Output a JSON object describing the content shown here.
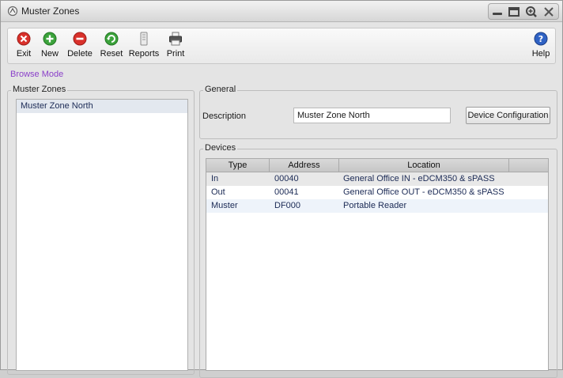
{
  "window": {
    "title": "Muster Zones"
  },
  "toolbar": {
    "exit": "Exit",
    "new": "New",
    "delete": "Delete",
    "reset": "Reset",
    "reports": "Reports",
    "print": "Print",
    "help": "Help"
  },
  "mode": "Browse Mode",
  "zones_panel": {
    "title": "Muster Zones",
    "items": [
      "Muster Zone North"
    ]
  },
  "general": {
    "title": "General",
    "description_label": "Description",
    "description_value": "Muster Zone North",
    "device_config_button": "Device Configuration"
  },
  "devices": {
    "title": "Devices",
    "columns": [
      "Type",
      "Address",
      "Location"
    ],
    "rows": [
      {
        "type": "In",
        "address": "00040",
        "location": "General Office IN - eDCM350 & sPASS"
      },
      {
        "type": "Out",
        "address": "00041",
        "location": "General Office OUT - eDCM350 & sPASS"
      },
      {
        "type": "Muster",
        "address": "DF000",
        "location": "Portable Reader"
      }
    ]
  },
  "colors": {
    "mode_text": "#8a3fc9",
    "selected_row": "#e3e8ef",
    "exit_red": "#d9312b",
    "new_green": "#3ba33b",
    "help_blue": "#2f62c4"
  }
}
